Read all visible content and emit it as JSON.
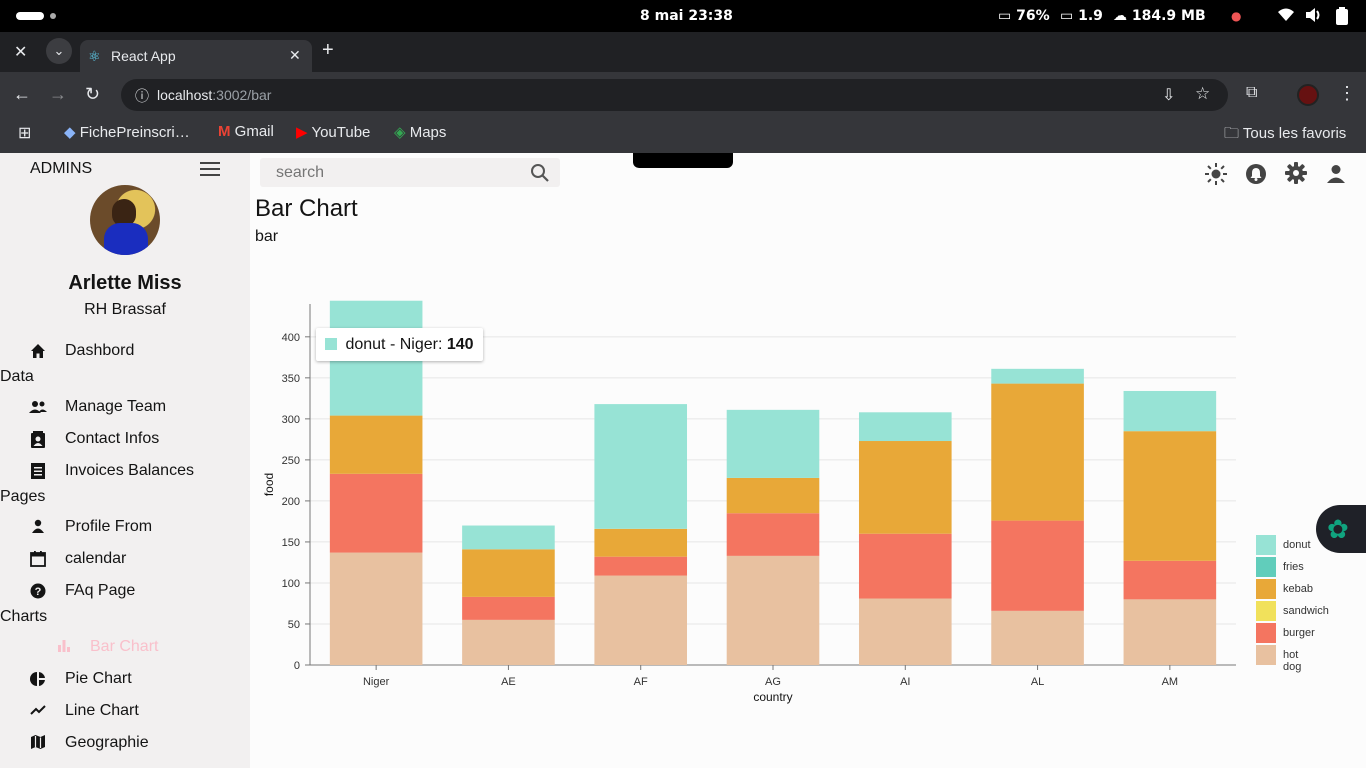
{
  "os": {
    "date_time": "8 mai  23:38",
    "battery_stat": "76%",
    "cpu_stat": "1.9",
    "memory_stat": "184.9 MB"
  },
  "browser": {
    "tab_title": "React App",
    "url_host": "localhost",
    "url_rest": ":3002/bar",
    "bookmarks": [
      "FichePreinscri…",
      "Gmail",
      "YouTube",
      "Maps"
    ],
    "all_bookmarks": "Tous les favoris"
  },
  "sidebar": {
    "brand": "ADMINS",
    "user_name": "Arlette Miss",
    "user_role": "RH Brassaf",
    "items": [
      {
        "label": "Dashbord",
        "icon": "home-icon"
      },
      {
        "section": "Data"
      },
      {
        "label": "Manage Team",
        "icon": "people-icon"
      },
      {
        "label": "Contact Infos",
        "icon": "contacts-icon"
      },
      {
        "label": "Invoices Balances",
        "icon": "receipt-icon"
      },
      {
        "section": "Pages"
      },
      {
        "label": "Profile From",
        "icon": "person-icon"
      },
      {
        "label": "calendar",
        "icon": "calendar-icon"
      },
      {
        "label": "FAq Page",
        "icon": "help-icon"
      },
      {
        "section": "Charts"
      },
      {
        "label": "Bar Chart",
        "icon": "bar-chart-icon",
        "active": true
      },
      {
        "label": "Pie Chart",
        "icon": "pie-chart-icon"
      },
      {
        "label": "Line Chart",
        "icon": "line-chart-icon"
      },
      {
        "label": "Geographie",
        "icon": "map-icon"
      }
    ]
  },
  "topbar": {
    "search_placeholder": "search"
  },
  "page": {
    "title": "Bar Chart",
    "subtitle": "bar"
  },
  "tooltip": {
    "label": "donut - Niger: ",
    "value": "140",
    "color": "#97e3d5"
  },
  "colors": {
    "active_nav": "#f9c0cb",
    "hot dog": "#e8c1a0",
    "burger": "#f47560",
    "sandwich": "#f1e15b",
    "kebab": "#e8a838",
    "fries": "#61cdbb",
    "donut": "#97e3d5"
  },
  "chart_data": {
    "type": "bar",
    "stacked": true,
    "xlabel": "country",
    "ylabel": "food",
    "ylim": [
      0,
      440
    ],
    "yticks": [
      0,
      50,
      100,
      150,
      200,
      250,
      300,
      350,
      400
    ],
    "categories": [
      "Niger",
      "AE",
      "AF",
      "AG",
      "AI",
      "AL",
      "AM"
    ],
    "series": [
      {
        "name": "hot dog",
        "values": [
          137,
          55,
          109,
          133,
          81,
          66,
          80
        ]
      },
      {
        "name": "burger",
        "values": [
          96,
          28,
          23,
          52,
          79,
          110,
          47
        ]
      },
      {
        "name": "sandwich",
        "values": [
          0,
          0,
          0,
          0,
          0,
          0,
          0
        ]
      },
      {
        "name": "kebab",
        "values": [
          71,
          58,
          34,
          43,
          113,
          167,
          158
        ]
      },
      {
        "name": "fries",
        "values": [
          0,
          0,
          0,
          0,
          0,
          0,
          0
        ]
      },
      {
        "name": "donut",
        "values": [
          140,
          29,
          152,
          83,
          35,
          18,
          49
        ]
      }
    ],
    "legend": [
      "donut",
      "fries",
      "kebab",
      "sandwich",
      "burger",
      "hot dog"
    ],
    "legend_position": "bottom-right",
    "grid": true
  }
}
